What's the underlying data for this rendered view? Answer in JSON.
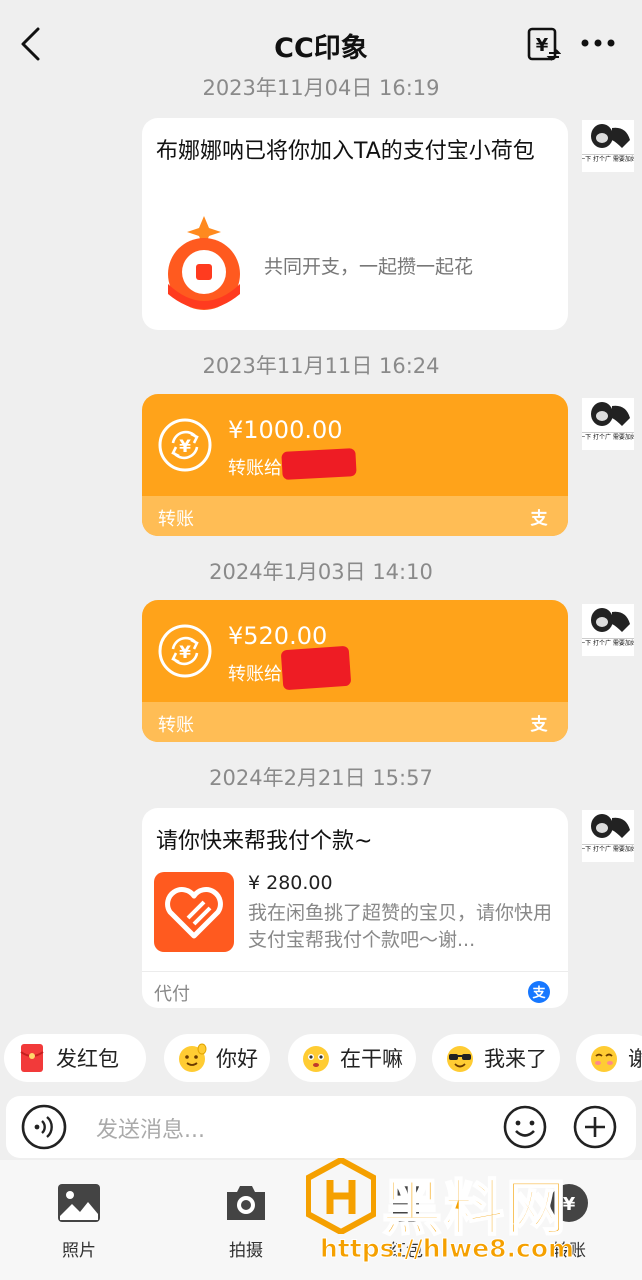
{
  "header": {
    "title": "CC印象"
  },
  "timestamps": [
    "2023年11月04日 16:19",
    "2023年11月11日 16:24",
    "2024年1月03日 14:10",
    "2024年2月21日 15:57"
  ],
  "xiaohebao": {
    "title": "布娜娜呐已将你加入TA的支付宝小荷包",
    "desc": "共同开支，一起攒一起花"
  },
  "transfers": [
    {
      "amount": "¥1000.00",
      "sub": "转账给",
      "footer": "转账"
    },
    {
      "amount": "¥520.00",
      "sub": "转账给",
      "footer": "转账"
    }
  ],
  "pay_request": {
    "title": "请你快来帮我付个款~",
    "amount": "¥ 280.00",
    "desc": "我在闲鱼挑了超赞的宝贝，请你快用支付宝帮我付个款吧～谢...",
    "footer": "代付"
  },
  "avatar_caption": "一下 打个广 需要加好",
  "quick_replies": [
    "发红包",
    "你好",
    "在干嘛",
    "我来了",
    "谢"
  ],
  "input": {
    "placeholder": "发送消息..."
  },
  "tools": [
    "照片",
    "拍摄",
    "红包",
    "转账"
  ],
  "watermark": {
    "brand": "黑料网",
    "url": "https://hlwe8.com"
  },
  "colors": {
    "transfer_orange": "#ffa31a",
    "transfer_footer": "#ffbd55",
    "redaction": "#ee1c24",
    "xianyu_orange": "#ff5a1f",
    "alipay_blue": "#1677ff"
  }
}
